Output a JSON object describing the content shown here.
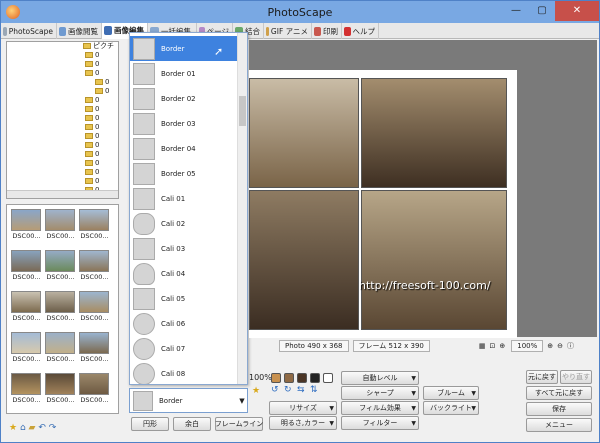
{
  "window": {
    "title": "PhotoScape",
    "minimize": "—",
    "maximize": "▢",
    "close": "✕"
  },
  "tabs": [
    {
      "label": "PhotoScape",
      "color": "#9aa7b5"
    },
    {
      "label": "画像閲覧",
      "color": "#6f9ad0"
    },
    {
      "label": "画像編集",
      "color": "#3f6db3"
    },
    {
      "label": "一括編集",
      "color": "#89a9d1"
    },
    {
      "label": "ページ",
      "color": "#b58ac7"
    },
    {
      "label": "結合",
      "color": "#6aa86a"
    },
    {
      "label": "GIF アニメ",
      "color": "#d0a04a"
    },
    {
      "label": "印刷",
      "color": "#c9584e"
    },
    {
      "label": "ヘルプ",
      "color": "#d33030"
    }
  ],
  "tree": {
    "root": "ピクチ",
    "items": [
      "0",
      "0",
      "0",
      "0",
      "0",
      "0",
      "0",
      "0",
      "0",
      "0",
      "0",
      "0",
      "0",
      "0",
      "0",
      "0"
    ]
  },
  "thumbnails": [
    "DSC00...",
    "DSC00...",
    "DSC00...",
    "DSC00...",
    "DSC00...",
    "DSC00...",
    "DSC00...",
    "DSC00...",
    "DSC00...",
    "DSC00...",
    "DSC00...",
    "DSC00...",
    "DSC00...",
    "DSC00...",
    "DSC00...",
    "DSC00...",
    "DSC00...",
    "DSC00..."
  ],
  "frame_options": [
    "Border",
    "Border 01",
    "Border 02",
    "Border 03",
    "Border 04",
    "Border 05",
    "Cali 01",
    "Cali 02",
    "Cali 03",
    "Cali 04",
    "Cali 05",
    "Cali 06",
    "Cali 07",
    "Cali 08"
  ],
  "frame_selected": "Border",
  "frame_buttons": {
    "round": "円形",
    "margin": "余白",
    "frameline": "フレームライン"
  },
  "status": {
    "photo": "Photo 490 x 368",
    "frame": "フレーム 512 x 390",
    "zoom": "100%"
  },
  "left_zoom": "100%",
  "tools": {
    "auto_level": "自動レベル",
    "sharpen": "シャープ",
    "bloom": "ブルーム",
    "resize": "リサイズ",
    "film_effect": "フィルム効果",
    "backlight": "バックライト",
    "bright_color": "明るさ,カラー",
    "filter": "フィルター",
    "undo": "元に戻す",
    "redo": "やり直す",
    "undo_all": "すべて元に戻す",
    "save": "保存",
    "menu": "メニュー"
  },
  "watermark": "http://freesoft-100.com/"
}
